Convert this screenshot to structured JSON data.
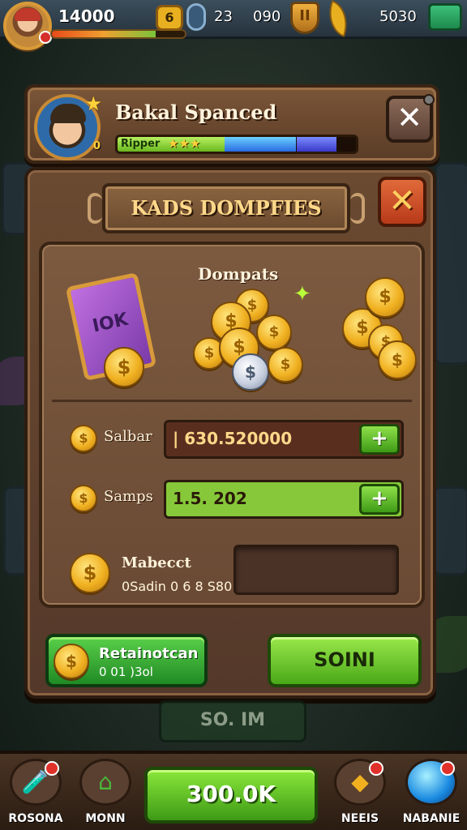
{
  "top_bar": {
    "xp_value": "14000",
    "xp_progress": 0.78,
    "xp_tag": "",
    "level_badge": "6",
    "stat_a": "23",
    "stat_b": "090",
    "shield_glyph": "II",
    "gems": "5030",
    "gem_button_glyph": "",
    "avatar_badge": ""
  },
  "profile": {
    "name": "Bakal Spanced",
    "level": "0",
    "bar_label": "Ripper",
    "bar_stars": "★★★",
    "bar_progress": {
      "green": 0.45,
      "blue": 0.3,
      "indigo": 0.17
    },
    "close_label": "✕"
  },
  "dialog": {
    "title": "KADS DOMPFIES",
    "close_label": "✕",
    "rewards_label": "Dompats",
    "card_text": "IOK",
    "stats": [
      {
        "label": "Salbar",
        "value": "| 630.520000",
        "color": "#5a2e1e",
        "value_color": "#ffd88a"
      },
      {
        "label": "Samps",
        "value": "1.5. 202",
        "color": "#86c83a",
        "value_color": "#2a1a08"
      }
    ],
    "medal": {
      "title": "Mabecct",
      "subtitle": "0Sadin 0 6 8 S80"
    },
    "bonus_button": {
      "title": "Retainotcan",
      "subtitle": "0 01 )3ol"
    },
    "main_button": "SOINI",
    "under_button": "SO. IM"
  },
  "bottom_nav": {
    "items": [
      {
        "label": "ROSONA",
        "icon": "bottle-icon",
        "badge": ""
      },
      {
        "label": "MONN",
        "icon": "home-icon",
        "badge": ""
      },
      {
        "label": "NEEIS",
        "icon": "ticket-icon",
        "badge": ""
      },
      {
        "label": "NABANIE",
        "icon": "orb-icon",
        "badge": ""
      }
    ],
    "cta": "300.0K"
  },
  "colors": {
    "accent_green": "#6ab820",
    "accent_red": "#c0392b",
    "wood": "#6a4a30",
    "gold": "#f0b020"
  }
}
